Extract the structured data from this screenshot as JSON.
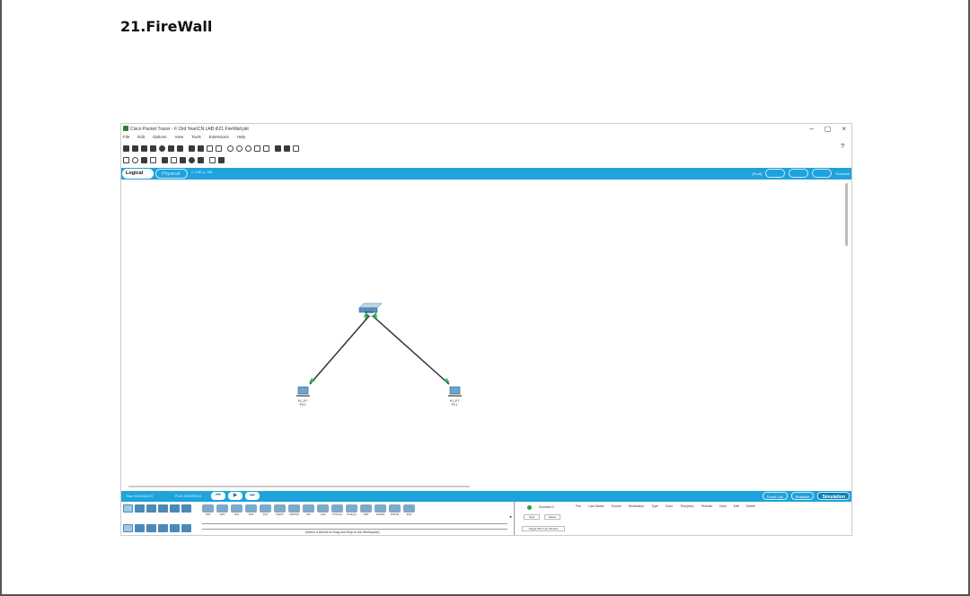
{
  "heading": "21.FireWall",
  "window": {
    "title": "Cisco Packet Tracer - F:\\3rd Year\\CN LAB d\\21.FireWall.pkt",
    "controls": [
      "–",
      "▢",
      "×"
    ],
    "help": "?"
  },
  "menu": [
    "File",
    "Edit",
    "Options",
    "View",
    "Tools",
    "Extensions",
    "Help"
  ],
  "view_tabs": {
    "logical": "Logical",
    "physical": "Physical",
    "coords": "x: 1330, y: 145",
    "right_label": "[Root]",
    "right_end": "Scenario"
  },
  "topology": {
    "switch": {
      "label": "Switch\n2950-24"
    },
    "pcs": [
      {
        "type": "PC-PT",
        "name": "PC0"
      },
      {
        "type": "PC-PT",
        "name": "PC1"
      }
    ],
    "link_color": "#333333",
    "port_color": "#22c55e"
  },
  "sim_bar": {
    "time": "Time: 00:00:00.673",
    "play_label": "PLAY CONTROLS",
    "buttons": [
      "⏮",
      "▶",
      "⏭"
    ],
    "event_list": "Event List",
    "realtime": "Realtime",
    "simulation": "Simulation"
  },
  "device_types": [
    "1941",
    "2901",
    "1941",
    "2811",
    "2911",
    "819IOX",
    "819HGW",
    "829",
    "1240",
    "PT-Router",
    "PT-Empty",
    "1841",
    "2620XM",
    "2621XM",
    "2811"
  ],
  "select_hint": "(Select a Device to Drag and Drop to the Workspace)",
  "scenario": {
    "label": "Scenario 0",
    "new": "New",
    "delete": "Delete",
    "toggle": "Toggle PDU List Window"
  },
  "pdu_columns": [
    "Fire",
    "Last Status",
    "Source",
    "Destination",
    "Type",
    "Color",
    "Time(sec)",
    "Periodic",
    "Num",
    "Edit",
    "Delete"
  ]
}
